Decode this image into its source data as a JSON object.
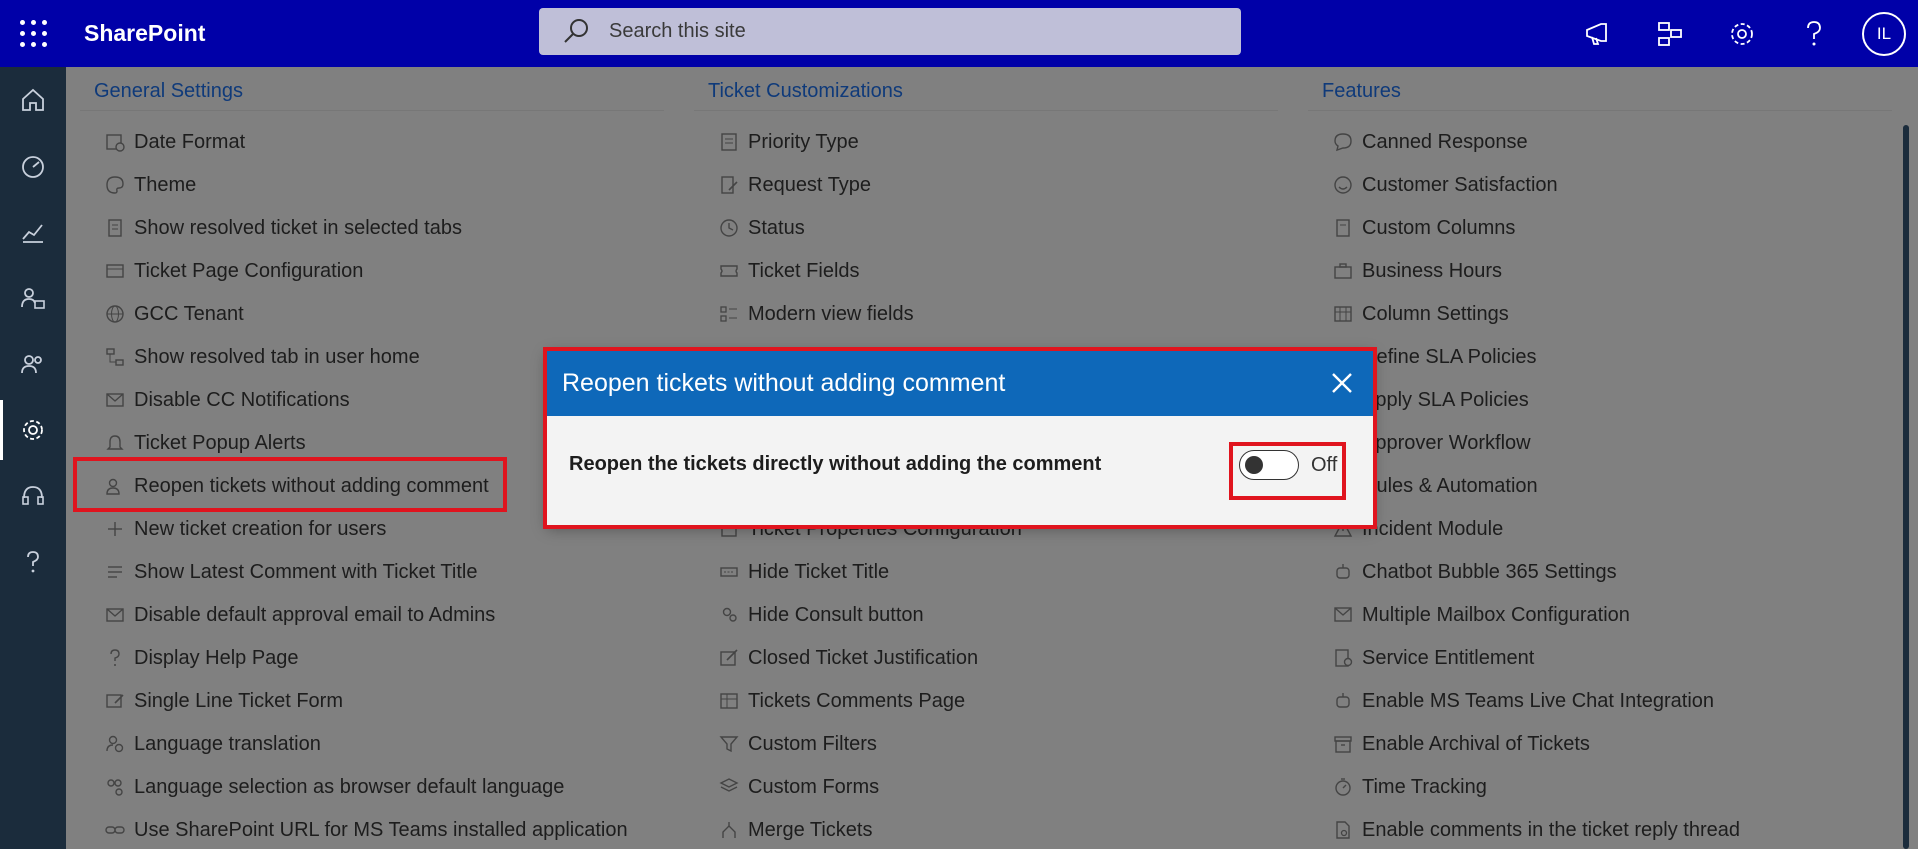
{
  "topbar": {
    "brand": "SharePoint",
    "search_placeholder": "Search this site",
    "avatar_initials": "IL"
  },
  "columns": [
    {
      "title": "General Settings",
      "items": [
        {
          "label": "Date Format",
          "icon": "calendar-clock-icon"
        },
        {
          "label": "Theme",
          "icon": "palette-icon"
        },
        {
          "label": "Show resolved ticket in selected tabs",
          "icon": "document-icon"
        },
        {
          "label": "Ticket Page Configuration",
          "icon": "window-icon"
        },
        {
          "label": "GCC Tenant",
          "icon": "globe-icon"
        },
        {
          "label": "Show resolved tab in user home",
          "icon": "tree-icon"
        },
        {
          "label": "Disable CC Notifications",
          "icon": "mail-off-icon"
        },
        {
          "label": "Ticket Popup Alerts",
          "icon": "bell-icon"
        },
        {
          "label": "Reopen tickets without adding comment",
          "icon": "people-icon"
        },
        {
          "label": "New ticket creation for users",
          "icon": "plus-icon"
        },
        {
          "label": "Show Latest Comment with Ticket Title",
          "icon": "lines-icon"
        },
        {
          "label": "Disable default approval email to Admins",
          "icon": "mail-icon"
        },
        {
          "label": "Display Help Page",
          "icon": "question-icon"
        },
        {
          "label": "Single Line Ticket Form",
          "icon": "form-edit-icon"
        },
        {
          "label": "Language translation",
          "icon": "person-gear-icon"
        },
        {
          "label": "Language selection as browser default language",
          "icon": "people-gear-icon"
        },
        {
          "label": "Use SharePoint URL for MS Teams installed application",
          "icon": "link-icon"
        }
      ]
    },
    {
      "title": "Ticket Customizations",
      "items": [
        {
          "label": "Priority Type",
          "icon": "list-icon"
        },
        {
          "label": "Request Type",
          "icon": "document-edit-icon"
        },
        {
          "label": "Status",
          "icon": "clock-icon"
        },
        {
          "label": "Ticket Fields",
          "icon": "ticket-icon"
        },
        {
          "label": "Modern view fields",
          "icon": "grid-list-icon"
        },
        {
          "label": "Ticket Properties Configuration",
          "icon": "properties-icon"
        },
        {
          "label": "Hide Ticket Title",
          "icon": "textbox-icon"
        },
        {
          "label": "Hide Consult button",
          "icon": "people-icon"
        },
        {
          "label": "Closed Ticket Justification",
          "icon": "edit-box-icon"
        },
        {
          "label": "Tickets Comments Page",
          "icon": "table-icon"
        },
        {
          "label": "Custom Filters",
          "icon": "filter-icon"
        },
        {
          "label": "Custom Forms",
          "icon": "layers-icon"
        },
        {
          "label": "Merge Tickets",
          "icon": "merge-icon"
        }
      ]
    },
    {
      "title": "Features",
      "items": [
        {
          "label": "Canned Response",
          "icon": "chat-icon"
        },
        {
          "label": "Customer Satisfaction",
          "icon": "smile-icon"
        },
        {
          "label": "Custom Columns",
          "icon": "document-icon"
        },
        {
          "label": "Business Hours",
          "icon": "briefcase-icon"
        },
        {
          "label": "Column Settings",
          "icon": "table-icon"
        },
        {
          "label": "Define SLA Policies",
          "icon": "policy-icon"
        },
        {
          "label": "Apply SLA Policies",
          "icon": "policy-check-icon"
        },
        {
          "label": "Approver Workflow",
          "icon": "workflow-icon"
        },
        {
          "label": "Rules & Automation",
          "icon": "automation-icon"
        },
        {
          "label": "Incident Module",
          "icon": "warning-icon"
        },
        {
          "label": "Chatbot Bubble 365 Settings",
          "icon": "bot-icon"
        },
        {
          "label": "Multiple Mailbox Configuration",
          "icon": "mailbox-icon"
        },
        {
          "label": "Service Entitlement",
          "icon": "entitlement-icon"
        },
        {
          "label": "Enable MS Teams Live Chat Integration",
          "icon": "bot-icon"
        },
        {
          "label": "Enable Archival of Tickets",
          "icon": "archive-icon"
        },
        {
          "label": "Time Tracking",
          "icon": "timer-icon"
        },
        {
          "label": "Enable comments in the ticket reply thread",
          "icon": "document-search-icon"
        }
      ]
    }
  ],
  "modal": {
    "title": "Reopen tickets without adding comment",
    "description": "Reopen the tickets directly without adding the comment",
    "toggle_state": "Off"
  },
  "colors": {
    "topbar": "#0000a8",
    "rail": "#1b2c3c",
    "modal_header": "#0e68b9",
    "highlight": "#e0141e"
  }
}
